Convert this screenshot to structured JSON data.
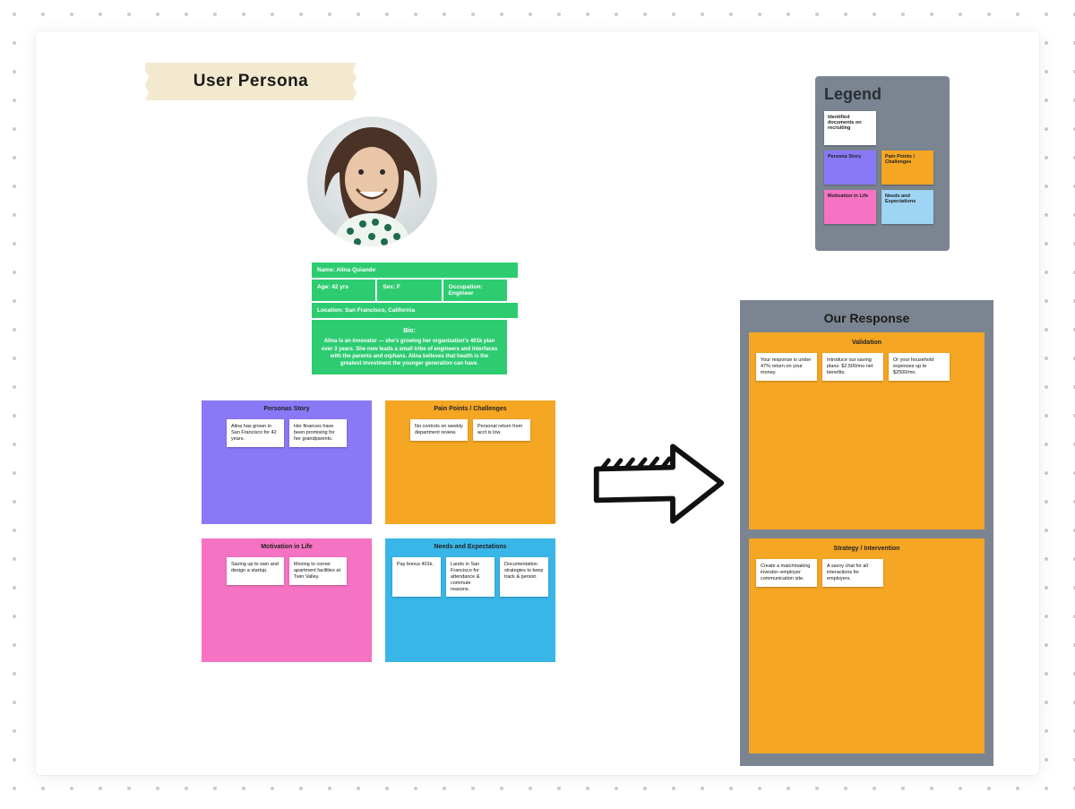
{
  "title": "User Persona",
  "info": {
    "name": "Name: Alina Quiande",
    "age": "Age: 42 yrs",
    "sex": "Sex: F",
    "occupation": "Occupation: Engineer",
    "location": "Location: San Francisco, California",
    "bio_title": "Bio:",
    "bio": "Alina is an innovator — she's growing her organization's 401k plan over 3 years. She now leads a small tribe of engineers and interfaces with the parents and orphans. Alina believes that health is the greatest investment the younger generation can have."
  },
  "quadrants": {
    "personas_story": {
      "title": "Personas Story",
      "items": [
        "Alina has grown in San Francisco for 42 years.",
        "Her finances have been promising for her grandparents."
      ]
    },
    "pain_points": {
      "title": "Pain Points / Challenges",
      "items": [
        "No controls on weekly department review.",
        "Personal return from acct is low."
      ]
    },
    "motivation": {
      "title": "Motivation in Life",
      "items": [
        "Saving up to own and design a startup.",
        "Moving to corner apartment facilities at Twin Valley."
      ]
    },
    "needs": {
      "title": "Needs and Expectations",
      "items": [
        "Pay bonus 401k.",
        "Lands in San Francisco for attendance & commute reasons.",
        "Documentation strategies to keep track & persist."
      ]
    }
  },
  "legend": {
    "title": "Legend",
    "items": [
      "Identified documents on recruiting",
      "Persona Story",
      "Pain Points / Challenges",
      "Motivation in Life",
      "Needs and Expectations"
    ]
  },
  "response": {
    "title": "Our Response",
    "validation": {
      "title": "Validation",
      "items": [
        "Your response is under 47% return on your money.",
        "Introduce our saving plans: $2,500/mo net benefits.",
        "Or your household expenses up to $2500/mo."
      ]
    },
    "intervention": {
      "title": "Strategy / Intervention",
      "items": [
        "Create a matchmaking investor–employer communication site.",
        "A savvy chat for all interactions for employers."
      ]
    }
  },
  "colors": {
    "purple": "#8a79f7",
    "orange": "#f5a623",
    "pink": "#f573c2",
    "blue": "#39b6e8",
    "green": "#2ecc71",
    "panel": "#7b8591"
  }
}
